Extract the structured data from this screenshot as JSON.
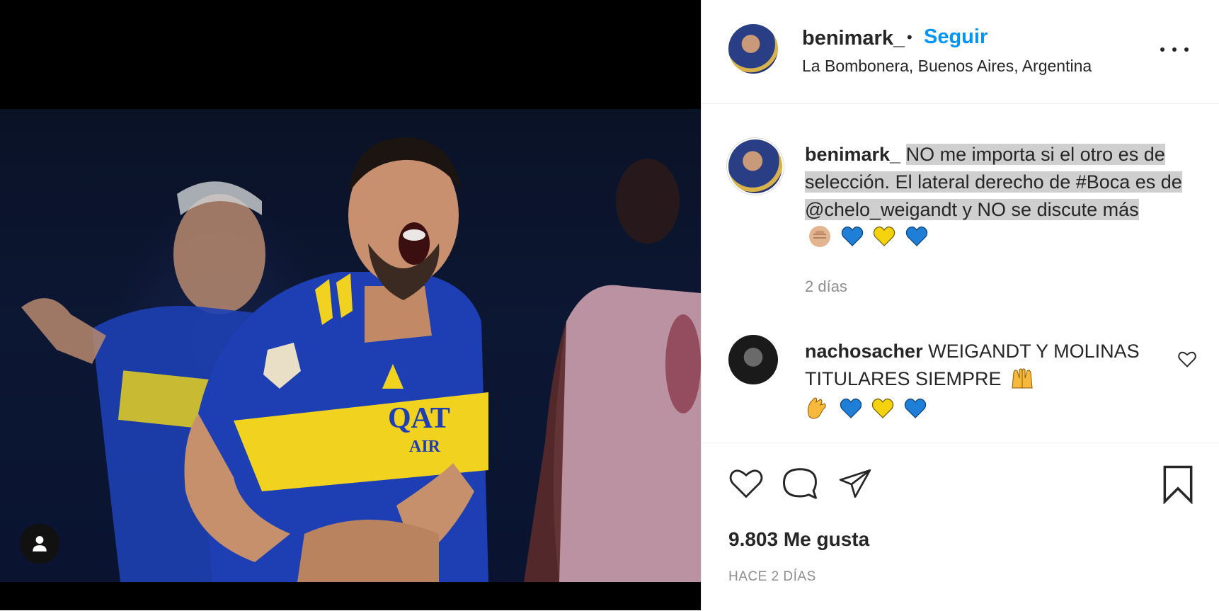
{
  "post": {
    "username": "benimark_",
    "separator": "•",
    "follow_label": "Seguir",
    "location": "La Bombonera, Buenos Aires, Argentina",
    "caption_text": "NO me importa si el otro es de selección. El lateral derecho de #Boca es de @chelo_weigandt y NO se discute más",
    "caption_emojis": [
      "fist-emoji",
      "blue-heart-emoji",
      "yellow-heart-emoji",
      "blue-heart-emoji"
    ],
    "caption_time": "2 días",
    "likes": "9.803 Me gusta",
    "post_time": "HACE 2 DÍAS"
  },
  "comment": {
    "username": "nachosacher",
    "text": "WEIGANDT Y MOLINAS TITULARES SIEMPRE",
    "emojis": [
      "raising-hands-emoji",
      "clapping-hands-emoji",
      "blue-heart-emoji",
      "yellow-heart-emoji",
      "blue-heart-emoji"
    ]
  },
  "colors": {
    "accent": "#0095f6",
    "text": "#262626",
    "muted": "#8e8e8e",
    "highlight": "#cfcfcf",
    "boca_blue": "#1d3fb3",
    "boca_yellow": "#f1d21f"
  }
}
